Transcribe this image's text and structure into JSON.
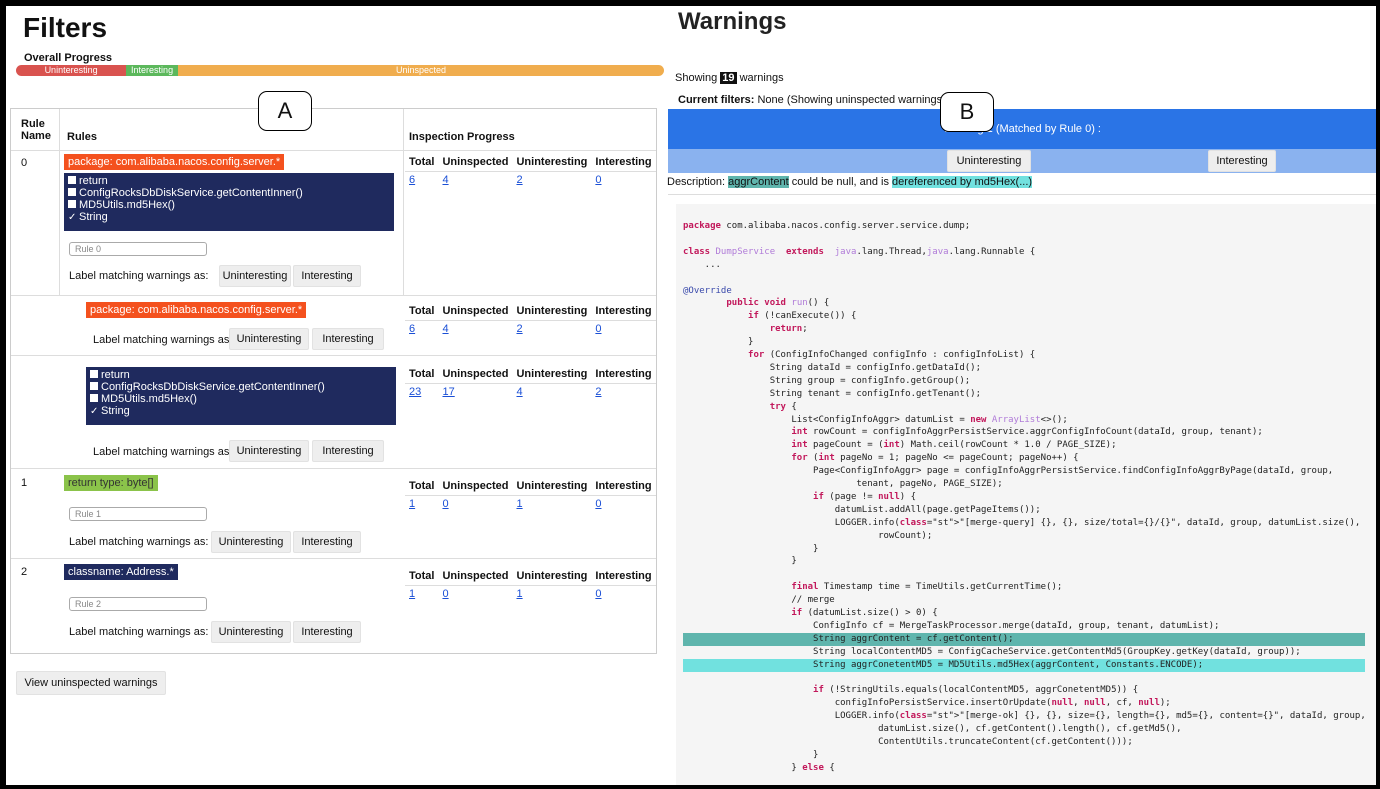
{
  "filters": {
    "title": "Filters",
    "overall_progress_label": "Overall Progress",
    "progress": {
      "uninteresting_label": "Uninteresting",
      "interesting_label": "Interesting",
      "uninspected_label": "Uninspected",
      "uninteresting_fraction": 0.17,
      "interesting_fraction": 0.08,
      "uninspected_fraction": 0.75,
      "colors": {
        "uninteresting": "#d9534f",
        "interesting": "#5cb85c",
        "uninspected": "#f0ad4e"
      }
    },
    "headers": {
      "rule_name_line1": "Rule",
      "rule_name_line2": "Name",
      "rules": "Rules",
      "inspection_progress": "Inspection Progress"
    },
    "stat_headers": {
      "total": "Total",
      "uninspected": "Uninspected",
      "uninteresting": "Uninteresting",
      "interesting": "Interesting"
    },
    "label_as": "Label matching warnings as:",
    "btn_uninteresting": "Uninteresting",
    "btn_interesting": "Interesting",
    "rules": [
      {
        "num": "0",
        "tag": "package: com.alibaba.nacos.config.server.*",
        "list": [
          "return",
          "ConfigRocksDbDiskService.getContentInner()",
          "MD5Utils.md5Hex()",
          "String"
        ],
        "input_placeholder": "Rule 0",
        "stats": {
          "total": "6",
          "uninspected": "4",
          "uninteresting": "2",
          "interesting": "0"
        }
      },
      {
        "num": "",
        "tag": "package: com.alibaba.nacos.config.server.*",
        "stats": {
          "total": "6",
          "uninspected": "4",
          "uninteresting": "2",
          "interesting": "0"
        }
      },
      {
        "num": "",
        "list": [
          "return",
          "ConfigRocksDbDiskService.getContentInner()",
          "MD5Utils.md5Hex()",
          "String"
        ],
        "stats": {
          "total": "23",
          "uninspected": "17",
          "uninteresting": "4",
          "interesting": "2"
        }
      },
      {
        "num": "1",
        "tag": "return type: byte[]",
        "input_placeholder": "Rule 1",
        "stats": {
          "total": "1",
          "uninspected": "0",
          "uninteresting": "1",
          "interesting": "0"
        }
      },
      {
        "num": "2",
        "tag": "classname: Address.*",
        "input_placeholder": "Rule 2",
        "stats": {
          "total": "1",
          "uninspected": "0",
          "uninteresting": "1",
          "interesting": "0"
        }
      }
    ],
    "view_uninspected": "View uninspected warnings"
  },
  "annotations": {
    "a": "A",
    "b": "B"
  },
  "warnings": {
    "title": "Warnings",
    "showing_prefix": "Showing",
    "showing_count": "19",
    "showing_suffix": "warnings",
    "current_filters_label": "Current filters:",
    "current_filters_value": "None (Showing uninspected warnings)",
    "header": "Warning 1 (Matched by Rule 0) :",
    "btn_uninteresting": "Uninteresting",
    "btn_interesting": "Interesting",
    "desc_prefix": "Description:",
    "desc_hl1": "aggrContent",
    "desc_mid": "could be null, and is",
    "desc_hl2": "dereferenced by md5Hex(...)",
    "code": [
      "package com.alibaba.nacos.config.server.service.dump;",
      "",
      "class DumpService  extends  java.lang.Thread,java.lang.Runnable {",
      "    ...",
      "",
      "@Override",
      "        public void run() {",
      "            if (!canExecute()) {",
      "                return;",
      "            }",
      "            for (ConfigInfoChanged configInfo : configInfoList) {",
      "                String dataId = configInfo.getDataId();",
      "                String group = configInfo.getGroup();",
      "                String tenant = configInfo.getTenant();",
      "                try {",
      "                    List<ConfigInfoAggr> datumList = new ArrayList<>();",
      "                    int rowCount = configInfoAggrPersistService.aggrConfigInfoCount(dataId, group, tenant);",
      "                    int pageCount = (int) Math.ceil(rowCount * 1.0 / PAGE_SIZE);",
      "                    for (int pageNo = 1; pageNo <= pageCount; pageNo++) {",
      "                        Page<ConfigInfoAggr> page = configInfoAggrPersistService.findConfigInfoAggrByPage(dataId, group,",
      "                                tenant, pageNo, PAGE_SIZE);",
      "                        if (page != null) {",
      "                            datumList.addAll(page.getPageItems());",
      "                            LOGGER.info(\"[merge-query] {}, {}, size/total={}/{}\", dataId, group, datumList.size(),",
      "                                    rowCount);",
      "                        }",
      "                    }",
      "",
      "                    final Timestamp time = TimeUtils.getCurrentTime();",
      "                    // merge",
      "                    if (datumList.size() > 0) {",
      "                        ConfigInfo cf = MergeTaskProcessor.merge(dataId, group, tenant, datumList);",
      "                        String aggrContent = cf.getContent();",
      "                        String localContentMD5 = ConfigCacheService.getContentMd5(GroupKey.getKey(dataId, group));",
      "                        String aggrConetentMD5 = MD5Utils.md5Hex(aggrContent, Constants.ENCODE);",
      "",
      "                        if (!StringUtils.equals(localContentMD5, aggrConetentMD5)) {",
      "                            configInfoPersistService.insertOrUpdate(null, null, cf, null);",
      "                            LOGGER.info(\"[merge-ok] {}, {}, size={}, length={}, md5={}, content={}\", dataId, group,",
      "                                    datumList.size(), cf.getContent().length(), cf.getMd5(),",
      "                                    ContentUtils.truncateContent(cf.getContent()));",
      "                        }",
      "                    } else {"
    ],
    "highlight_a_line": 32,
    "highlight_b_line": 34
  }
}
